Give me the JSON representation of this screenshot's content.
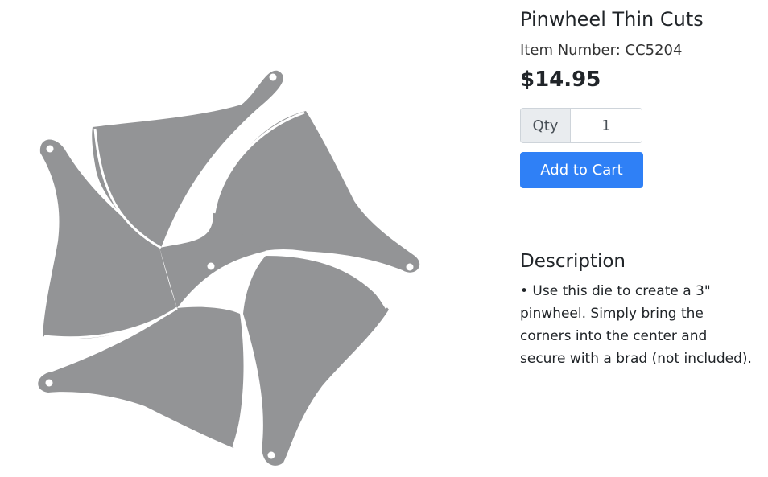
{
  "product": {
    "title": "Pinwheel Thin Cuts",
    "item_number": "Item Number: CC5204",
    "price": "$14.95",
    "image_description_icon": "pinwheel-die-image",
    "image_color": "#939496"
  },
  "purchase": {
    "qty_label": "Qty",
    "qty_value": "1",
    "add_to_cart_label": "Add to Cart",
    "button_color": "#2f80f6"
  },
  "description": {
    "heading": "Description",
    "lines": [
      "• Use this die to create a 3\"",
      "pinwheel. Simply bring the",
      "corners into the center and",
      "secure with a brad (not included)."
    ]
  }
}
